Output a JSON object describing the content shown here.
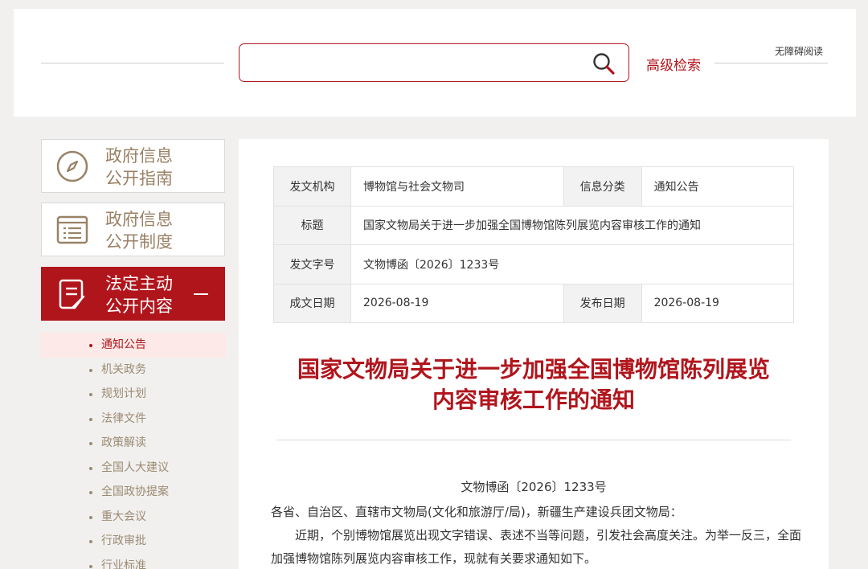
{
  "header": {
    "search_placeholder": "",
    "advanced_search": "高级检索",
    "accessibility": "无障碍阅读"
  },
  "sidebar": {
    "boxes": [
      {
        "line1": "政府信息",
        "line2": "公开指南",
        "icon": "compass-icon"
      },
      {
        "line1": "政府信息",
        "line2": "公开制度",
        "icon": "list-document-icon"
      },
      {
        "line1": "法定主动",
        "line2": "公开内容",
        "icon": "document-edit-icon"
      }
    ],
    "items": [
      "通知公告",
      "机关政务",
      "规划计划",
      "法律文件",
      "政策解读",
      "全国人大建议",
      "全国政协提案",
      "重大会议",
      "行政审批",
      "行业标准"
    ]
  },
  "meta": {
    "issuer_label": "发文机构",
    "issuer": "博物馆与社会文物司",
    "category_label": "信息分类",
    "category": "通知公告",
    "title_label": "标题",
    "title": "国家文物局关于进一步加强全国博物馆陈列展览内容审核工作的通知",
    "docno_label": "发文字号",
    "docno": "文物博函〔2026〕1233号",
    "created_label": "成文日期",
    "created": "2026-08-19",
    "published_label": "发布日期",
    "published": "2026-08-19"
  },
  "article": {
    "title_line1": "国家文物局关于进一步加强全国博物馆陈列展览",
    "title_line2": "内容审核工作的通知",
    "doc_number": "文物博函〔2026〕1233号",
    "addressee": "各省、自治区、直辖市文物局(文化和旅游厅/局)，新疆生产建设兵团文物局：",
    "para1": "近期，个别博物馆展览出现文字错误、表述不当等问题，引发社会高度关注。为举一反三，全面加强博物馆陈列展览内容审核工作，现就有关要求通知如下。"
  },
  "colors": {
    "brand_red": "#b1151c",
    "tan": "#9a8266"
  }
}
